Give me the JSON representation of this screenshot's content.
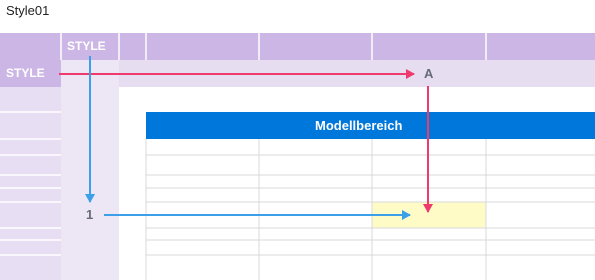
{
  "caption": "Style01",
  "col_header": "STYLE",
  "row_header": "STYLE",
  "marker_a": "A",
  "marker_1": "1",
  "title": "Modellbereich",
  "colors": {
    "header_purple": "#cbb6e6",
    "row_band": "#e6ddf1",
    "title_blue": "#0077db",
    "highlight": "#fffbc7",
    "arrow_pink": "#ee3a6c",
    "arrow_blue": "#3b9fe9"
  }
}
